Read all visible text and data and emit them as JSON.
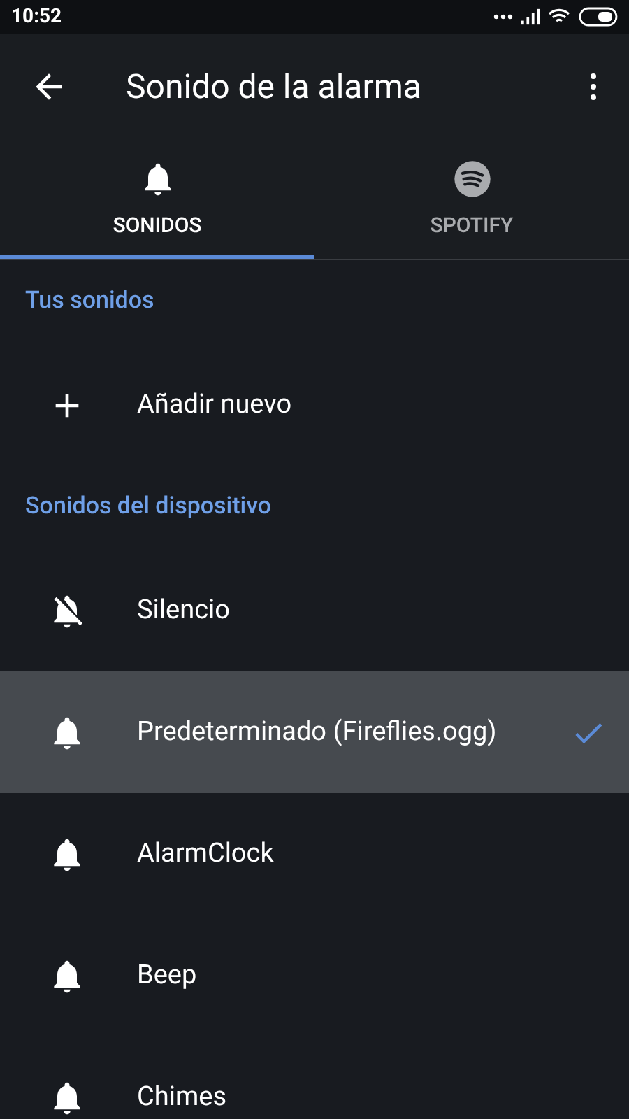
{
  "status_bar": {
    "time": "10:52"
  },
  "app_bar": {
    "title": "Sonido de la alarma"
  },
  "tabs": [
    {
      "label": "SONIDOS",
      "kind": "bell",
      "selected": true
    },
    {
      "label": "SPOTIFY",
      "kind": "stream",
      "selected": false
    }
  ],
  "sections": [
    {
      "title": "Tus sonidos",
      "items": [
        {
          "label": "Añadir nuevo",
          "kind": "add",
          "selected": false
        }
      ]
    },
    {
      "title": "Sonidos del dispositivo",
      "items": [
        {
          "label": "Silencio",
          "kind": "silent",
          "selected": false
        },
        {
          "label": "Predeterminado (Fireflies.ogg)",
          "kind": "bell",
          "selected": true
        },
        {
          "label": "AlarmClock",
          "kind": "bell",
          "selected": false
        },
        {
          "label": "Beep",
          "kind": "bell",
          "selected": false
        },
        {
          "label": "Chimes",
          "kind": "bell",
          "selected": false
        }
      ]
    }
  ]
}
